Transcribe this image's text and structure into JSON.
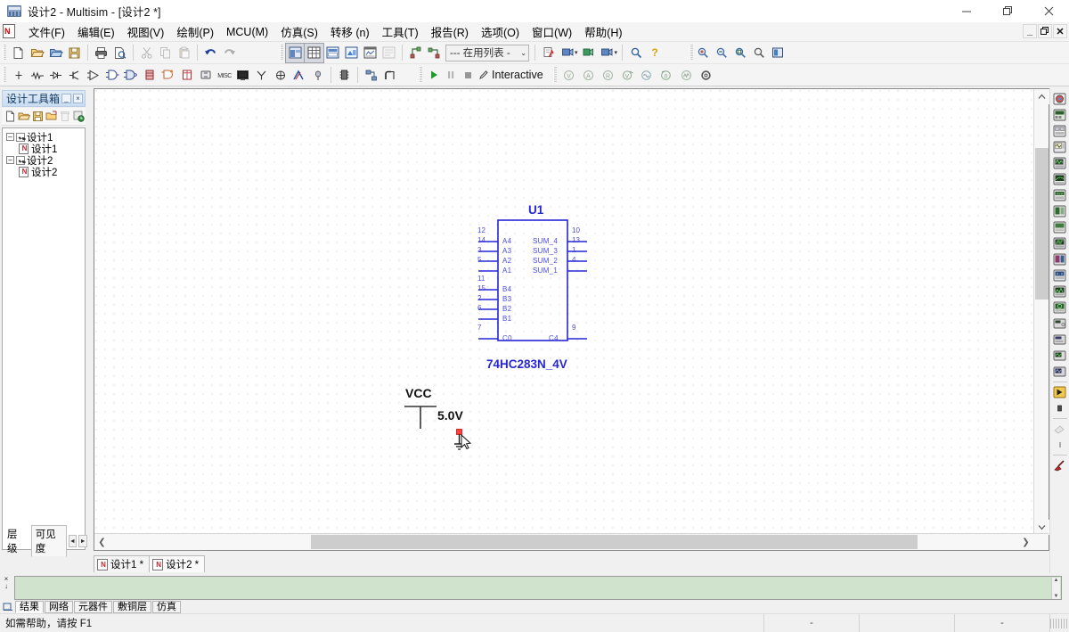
{
  "window": {
    "title": "设计2 - Multisim - [设计2 *]",
    "app_icon": "multisim-logo-icon",
    "controls": {
      "minimize": "–",
      "maximize": "❐",
      "close": "✕"
    }
  },
  "mdi_controls": {
    "minimize": "_",
    "restore": "❐",
    "close": "✕"
  },
  "menubar": {
    "app_icon": "new-design-icon",
    "items": [
      {
        "label": "文件(F)",
        "name": "menu-file"
      },
      {
        "label": "编辑(E)",
        "name": "menu-edit"
      },
      {
        "label": "视图(V)",
        "name": "menu-view"
      },
      {
        "label": "绘制(P)",
        "name": "menu-place"
      },
      {
        "label": "MCU(M)",
        "name": "menu-mcu"
      },
      {
        "label": "仿真(S)",
        "name": "menu-simulate"
      },
      {
        "label": "转移 (n)",
        "name": "menu-transfer"
      },
      {
        "label": "工具(T)",
        "name": "menu-tools"
      },
      {
        "label": "报告(R)",
        "name": "menu-reports"
      },
      {
        "label": "选项(O)",
        "name": "menu-options"
      },
      {
        "label": "窗口(W)",
        "name": "menu-window"
      },
      {
        "label": "帮助(H)",
        "name": "menu-help"
      }
    ]
  },
  "toolbar_standard": [
    {
      "name": "new-file-button",
      "icon": "new-document-icon"
    },
    {
      "name": "open-file-button",
      "icon": "open-folder-icon"
    },
    {
      "name": "open-sample-button",
      "icon": "open-folder-blue-icon"
    },
    {
      "name": "save-button",
      "icon": "floppy-disk-icon"
    },
    {
      "name": "print-button",
      "icon": "printer-icon"
    },
    {
      "name": "print-preview-button",
      "icon": "print-preview-icon"
    },
    {
      "name": "cut-button",
      "icon": "scissors-icon"
    },
    {
      "name": "copy-button",
      "icon": "copy-icon"
    },
    {
      "name": "paste-button",
      "icon": "paste-icon"
    },
    {
      "name": "undo-button",
      "icon": "undo-arrow-icon"
    },
    {
      "name": "redo-button",
      "icon": "redo-arrow-icon"
    }
  ],
  "toolbar_view": [
    {
      "name": "toggle-design-toolbox-button",
      "icon": "design-toolbox-icon"
    },
    {
      "name": "toggle-spreadsheet-view-button",
      "icon": "spreadsheet-view-icon"
    },
    {
      "name": "database-manager-button",
      "icon": "database-manager-icon"
    },
    {
      "name": "create-component-button",
      "icon": "create-component-icon"
    },
    {
      "name": "grapher-button",
      "icon": "grapher-icon"
    },
    {
      "name": "postprocessor-button",
      "icon": "postprocessor-icon"
    },
    {
      "name": "electrical-rules-check-button",
      "icon": "erc-check-icon"
    },
    {
      "name": "capture-screen-area-button",
      "icon": "capture-area-icon"
    }
  ],
  "inuse_list": {
    "label": "--- 在用列表 -",
    "caret": "⌄",
    "name": "in-use-list-combo"
  },
  "toolbar_probe": [
    {
      "name": "place-probe-button",
      "icon": "measurement-probe-icon"
    },
    {
      "name": "run-ngspice-button",
      "icon": "ngspice-run-icon"
    },
    {
      "name": "back-annotate-button",
      "icon": "back-annotate-icon"
    },
    {
      "name": "forward-annotate-button",
      "icon": "forward-annotate-icon"
    },
    {
      "name": "find-button",
      "icon": "magnifier-icon"
    },
    {
      "name": "help-button",
      "icon": "help-question-icon"
    }
  ],
  "toolbar_zoom": [
    {
      "name": "zoom-in-button",
      "icon": "zoom-in-icon"
    },
    {
      "name": "zoom-out-button",
      "icon": "zoom-out-icon"
    },
    {
      "name": "zoom-area-button",
      "icon": "zoom-area-icon"
    },
    {
      "name": "zoom-fit-button",
      "icon": "zoom-fit-icon"
    },
    {
      "name": "zoom-full-screen-button",
      "icon": "full-screen-icon"
    }
  ],
  "toolbar_components": [
    {
      "name": "place-source-button",
      "icon": "source-icon"
    },
    {
      "name": "place-basic-button",
      "icon": "resistor-icon"
    },
    {
      "name": "place-diode-button",
      "icon": "diode-icon"
    },
    {
      "name": "place-transistor-button",
      "icon": "transistor-icon"
    },
    {
      "name": "place-analog-button",
      "icon": "opamp-icon"
    },
    {
      "name": "place-ttl-button",
      "icon": "ttl-chip-icon"
    },
    {
      "name": "place-cmos-button",
      "icon": "cmos-chip-icon"
    },
    {
      "name": "place-misc-digital-button",
      "icon": "misc-digital-icon"
    },
    {
      "name": "place-mixed-button",
      "icon": "mixed-component-icon"
    },
    {
      "name": "place-indicator-button",
      "icon": "indicator-icon"
    },
    {
      "name": "place-power-button",
      "icon": "power-component-icon"
    },
    {
      "name": "place-misc-button",
      "icon": "misc-component-icon"
    },
    {
      "name": "place-advanced-peripherals-button",
      "icon": "peripherals-icon"
    },
    {
      "name": "place-rf-button",
      "icon": "rf-component-icon"
    },
    {
      "name": "place-electromechanical-button",
      "icon": "electromechanical-icon"
    },
    {
      "name": "place-ni-components-button",
      "icon": "ni-component-icon"
    },
    {
      "name": "place-connectors-button",
      "icon": "connector-icon"
    },
    {
      "name": "place-mcu-button",
      "icon": "mcu-module-icon"
    },
    {
      "name": "place-hierarchical-block-button",
      "icon": "hierarchical-block-icon"
    },
    {
      "name": "place-bus-button",
      "icon": "bus-icon"
    }
  ],
  "simulation": {
    "run_icon": "run-play-icon",
    "pause_icon": "pause-icon",
    "stop_icon": "stop-icon",
    "mode_icon": "pencil-icon",
    "mode_label": "Interactive",
    "analysis_buttons": [
      {
        "name": "dc-operating-point-button",
        "icon": "analysis-v-icon"
      },
      {
        "name": "ac-sweep-button",
        "icon": "analysis-a-icon"
      },
      {
        "name": "transient-button",
        "icon": "analysis-r-icon"
      },
      {
        "name": "dc-sweep-button",
        "icon": "analysis-dc-icon"
      },
      {
        "name": "single-frequency-ac-button",
        "icon": "analysis-freq-icon"
      },
      {
        "name": "parameter-sweep-button",
        "icon": "analysis-param-icon"
      },
      {
        "name": "noise-analysis-button",
        "icon": "analysis-noise-icon"
      },
      {
        "name": "analysis-settings-button",
        "icon": "gear-icon"
      }
    ]
  },
  "design_toolbox": {
    "title": "设计工具箱",
    "minimize_glyph": "_",
    "close_glyph": "×",
    "toolbar": [
      {
        "name": "new-design-button",
        "icon": "new-document-icon"
      },
      {
        "name": "open-design-button",
        "icon": "open-folder-icon"
      },
      {
        "name": "save-design-button",
        "icon": "floppy-disk-icon"
      },
      {
        "name": "close-design-button",
        "icon": "close-folder-icon"
      },
      {
        "name": "delete-design-button",
        "icon": "trash-icon"
      },
      {
        "name": "refresh-design-button",
        "icon": "refresh-clock-icon"
      }
    ],
    "tree": [
      {
        "label": "设计1",
        "level": 1,
        "checked": true,
        "icon": "folder-expand-icon"
      },
      {
        "label": "设计1",
        "level": 2,
        "checked": false,
        "icon": "schematic-document-icon"
      },
      {
        "label": "设计2",
        "level": 1,
        "checked": true,
        "icon": "folder-expand-icon"
      },
      {
        "label": "设计2",
        "level": 2,
        "checked": false,
        "icon": "schematic-document-icon"
      }
    ],
    "tabs": [
      {
        "label": "层级",
        "name": "tab-hierarchy",
        "selected": false
      },
      {
        "label": "可见度",
        "name": "tab-visibility",
        "selected": true
      }
    ],
    "nav_prev": "◄",
    "nav_next": "►"
  },
  "canvas": {
    "scroll_h_left": "❮",
    "scroll_h_right": "❯",
    "scroll_v_up": "⌃",
    "scroll_v_down": "⌄",
    "cursor_icon": "place-ground-cursor-icon"
  },
  "schematic": {
    "ic": {
      "ref": "U1",
      "part_name": "74HC283N_4V",
      "left_pins": [
        {
          "num": "12",
          "label": ""
        },
        {
          "num": "14",
          "label": "A4"
        },
        {
          "num": "3",
          "label": "A3"
        },
        {
          "num": "5",
          "label": "A2"
        },
        {
          "num": "",
          "label": "A1"
        },
        {
          "num": "11",
          "label": ""
        },
        {
          "num": "15",
          "label": "B4"
        },
        {
          "num": "2",
          "label": "B3"
        },
        {
          "num": "6",
          "label": "B2"
        },
        {
          "num": "",
          "label": "B1"
        },
        {
          "num": "7",
          "label": ""
        },
        {
          "num": "",
          "label": "C0"
        }
      ],
      "right_pins": [
        {
          "num": "10",
          "label": ""
        },
        {
          "num": "13",
          "label": "SUM_4"
        },
        {
          "num": "1",
          "label": "SUM_3"
        },
        {
          "num": "4",
          "label": "SUM_2"
        },
        {
          "num": "",
          "label": "SUM_1"
        },
        {
          "num": "9",
          "label": ""
        },
        {
          "num": "",
          "label": "C4"
        }
      ]
    },
    "vcc": {
      "label": "VCC",
      "value": "5.0V"
    }
  },
  "document_tabs": [
    {
      "label": "设计1 *",
      "name": "doc-tab-design1",
      "selected": false,
      "icon": "schematic-document-icon"
    },
    {
      "label": "设计2 *",
      "name": "doc-tab-design2",
      "selected": true,
      "icon": "schematic-document-icon"
    }
  ],
  "instruments": [
    {
      "name": "instrument-multimeter",
      "icon": "multimeter-icon"
    },
    {
      "name": "instrument-function-generator",
      "icon": "function-generator-icon"
    },
    {
      "name": "instrument-wattmeter",
      "icon": "wattmeter-icon"
    },
    {
      "name": "instrument-oscilloscope",
      "icon": "oscilloscope-icon"
    },
    {
      "name": "instrument-four-channel-oscilloscope",
      "icon": "four-channel-scope-icon"
    },
    {
      "name": "instrument-bode-plotter",
      "icon": "bode-plotter-icon"
    },
    {
      "name": "instrument-frequency-counter",
      "icon": "frequency-counter-icon"
    },
    {
      "name": "instrument-word-generator",
      "icon": "word-generator-icon"
    },
    {
      "name": "instrument-logic-converter",
      "icon": "logic-converter-icon"
    },
    {
      "name": "instrument-logic-analyzer",
      "icon": "logic-analyzer-icon"
    },
    {
      "name": "instrument-iv-analyzer",
      "icon": "iv-analyzer-icon"
    },
    {
      "name": "instrument-distortion-analyzer",
      "icon": "distortion-analyzer-icon"
    },
    {
      "name": "instrument-spectrum-analyzer",
      "icon": "spectrum-analyzer-icon"
    },
    {
      "name": "instrument-network-analyzer",
      "icon": "network-analyzer-icon"
    },
    {
      "name": "instrument-agilent-function-generator",
      "icon": "agilent-fgen-icon"
    },
    {
      "name": "instrument-agilent-multimeter",
      "icon": "agilent-multimeter-icon"
    },
    {
      "name": "instrument-agilent-oscilloscope",
      "icon": "agilent-scope-icon"
    },
    {
      "name": "instrument-tektronix-oscilloscope",
      "icon": "tektronix-scope-icon"
    },
    {
      "name": "instrument-labview",
      "icon": "labview-icon"
    },
    {
      "name": "instrument-ni-elvis",
      "icon": "ni-elvis-icon"
    },
    {
      "name": "instrument-current-probe",
      "icon": "current-probe-icon"
    },
    {
      "name": "instrument-measurement-probe",
      "icon": "measurement-probe-icon"
    }
  ],
  "spreadsheet_view": {
    "close_glyph": "×",
    "dock_glyph": "↓",
    "pin_icon": "pin-icon",
    "scroll_up": "▲",
    "scroll_down": "▼",
    "tabs": [
      {
        "label": "结果",
        "name": "sv-tab-results",
        "selected": true
      },
      {
        "label": "网络",
        "name": "sv-tab-nets",
        "selected": false
      },
      {
        "label": "元器件",
        "name": "sv-tab-components",
        "selected": false
      },
      {
        "label": "敷铜层",
        "name": "sv-tab-copper-layers",
        "selected": false
      },
      {
        "label": "仿真",
        "name": "sv-tab-simulation",
        "selected": false
      }
    ]
  },
  "statusbar": {
    "message": "如需帮助，请按 F1",
    "cell1": "-",
    "cell2": "",
    "cell3": "-"
  },
  "colors": {
    "schematic_blue": "#2626d6",
    "pin_blue": "#4a4ae0",
    "title_panel": "#c9ddf2",
    "spreadsheet_green": "#cfe3cd",
    "run_green": "#1f9c2a",
    "cursor_red": "#e03030"
  }
}
